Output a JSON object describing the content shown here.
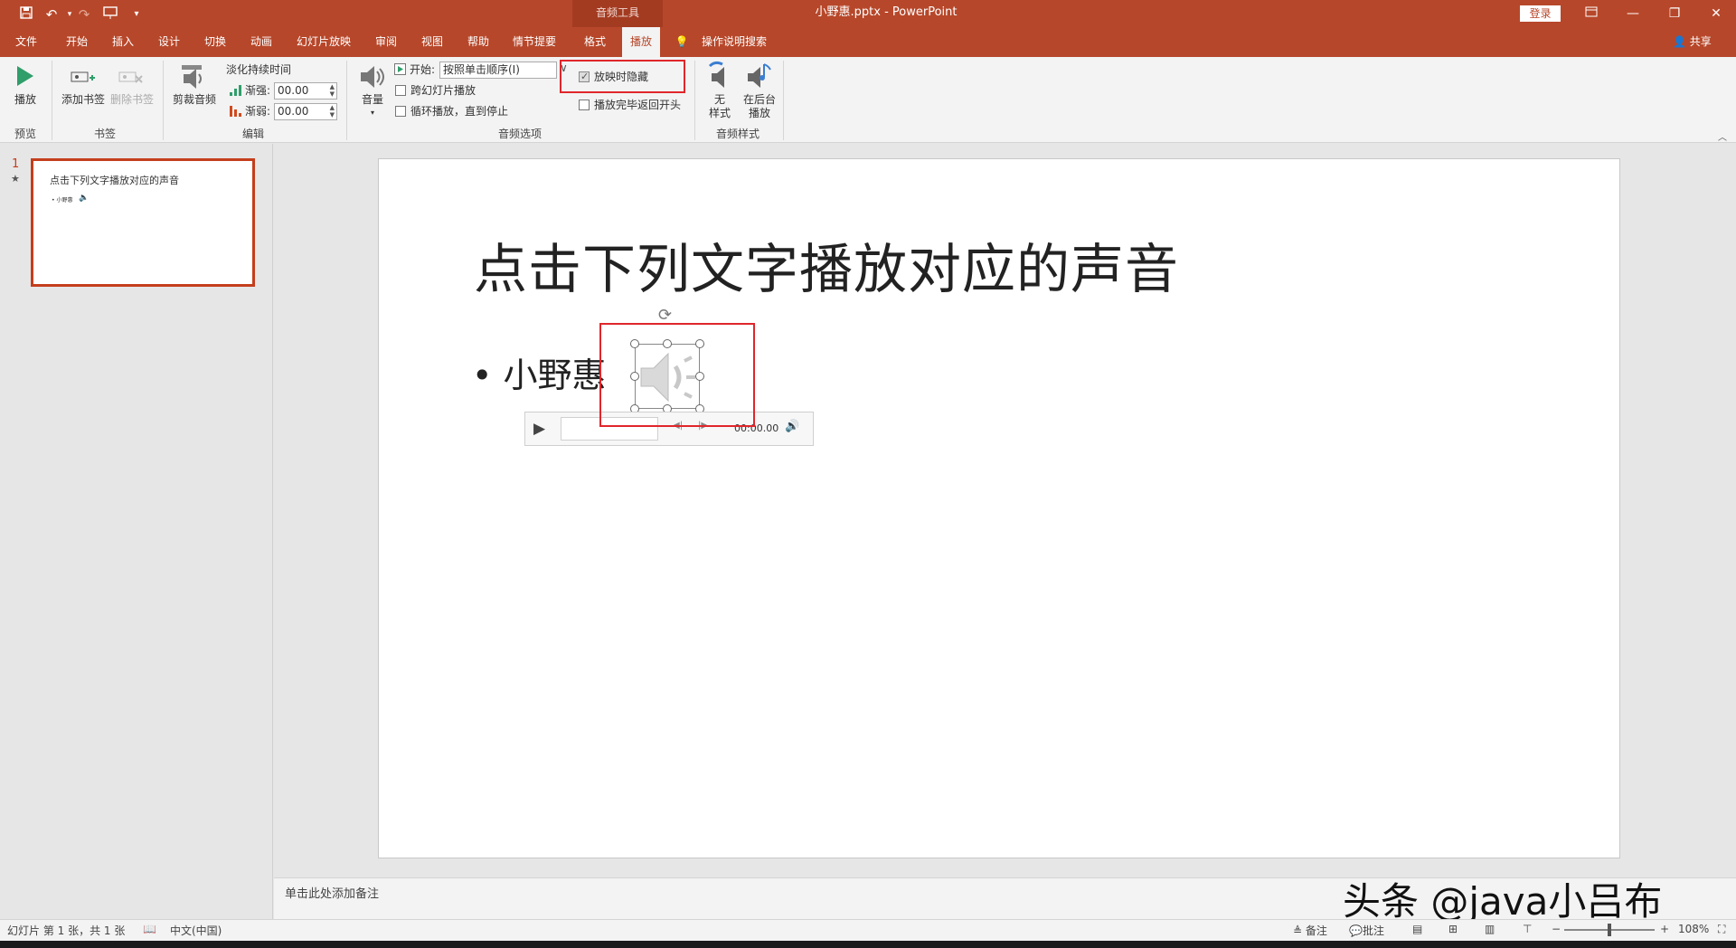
{
  "titlebar": {
    "context_tools": "音频工具",
    "doc_title": "小野惠.pptx  -  PowerPoint",
    "login": "登录",
    "icons": [
      "save-icon",
      "undo-icon",
      "redo-icon",
      "present-icon",
      "customize-icon"
    ]
  },
  "tabs": [
    "文件",
    "开始",
    "插入",
    "设计",
    "切换",
    "动画",
    "幻灯片放映",
    "审阅",
    "视图",
    "帮助",
    "情节提要",
    "格式",
    "播放"
  ],
  "search_label": "操作说明搜索",
  "share_label": "共享",
  "ribbon": {
    "preview": {
      "play": "播放",
      "group": "预览"
    },
    "bookmarks": {
      "add": "添加书签",
      "remove": "删除书签",
      "group": "书签"
    },
    "editing": {
      "trim": "剪裁音频",
      "fade_title": "淡化持续时间",
      "fade_in_label": "渐强:",
      "fade_in_value": "00.00",
      "fade_out_label": "渐弱:",
      "fade_out_value": "00.00",
      "group": "编辑"
    },
    "audio_options": {
      "volume": "音量",
      "start_label": "开始:",
      "start_value": "按照单击顺序(I)",
      "cross_slides": "跨幻灯片播放",
      "loop": "循环播放，直到停止",
      "hide_during_show": "放映时隐藏",
      "rewind": "播放完毕返回开头",
      "group": "音频选项"
    },
    "audio_styles": {
      "no_style_line1": "无",
      "no_style_line2": "样式",
      "background_line1": "在后台",
      "background_line2": "播放",
      "group": "音频样式"
    }
  },
  "thumbnails": {
    "number": "1",
    "star": "★",
    "title": "点击下列文字播放对应的声音",
    "bullet": "• 小野惠"
  },
  "slide": {
    "title": "点击下列文字播放对应的声音",
    "bullet": "• 小野惠",
    "player_time": "00:00.00"
  },
  "notes_placeholder": "单击此处添加备注",
  "watermark": "头条 @java小吕布",
  "status": {
    "slide_info": "幻灯片 第 1 张，共 1 张",
    "language": "中文(中国)",
    "notes": "备注",
    "comments": "批注",
    "zoom": "108%"
  }
}
